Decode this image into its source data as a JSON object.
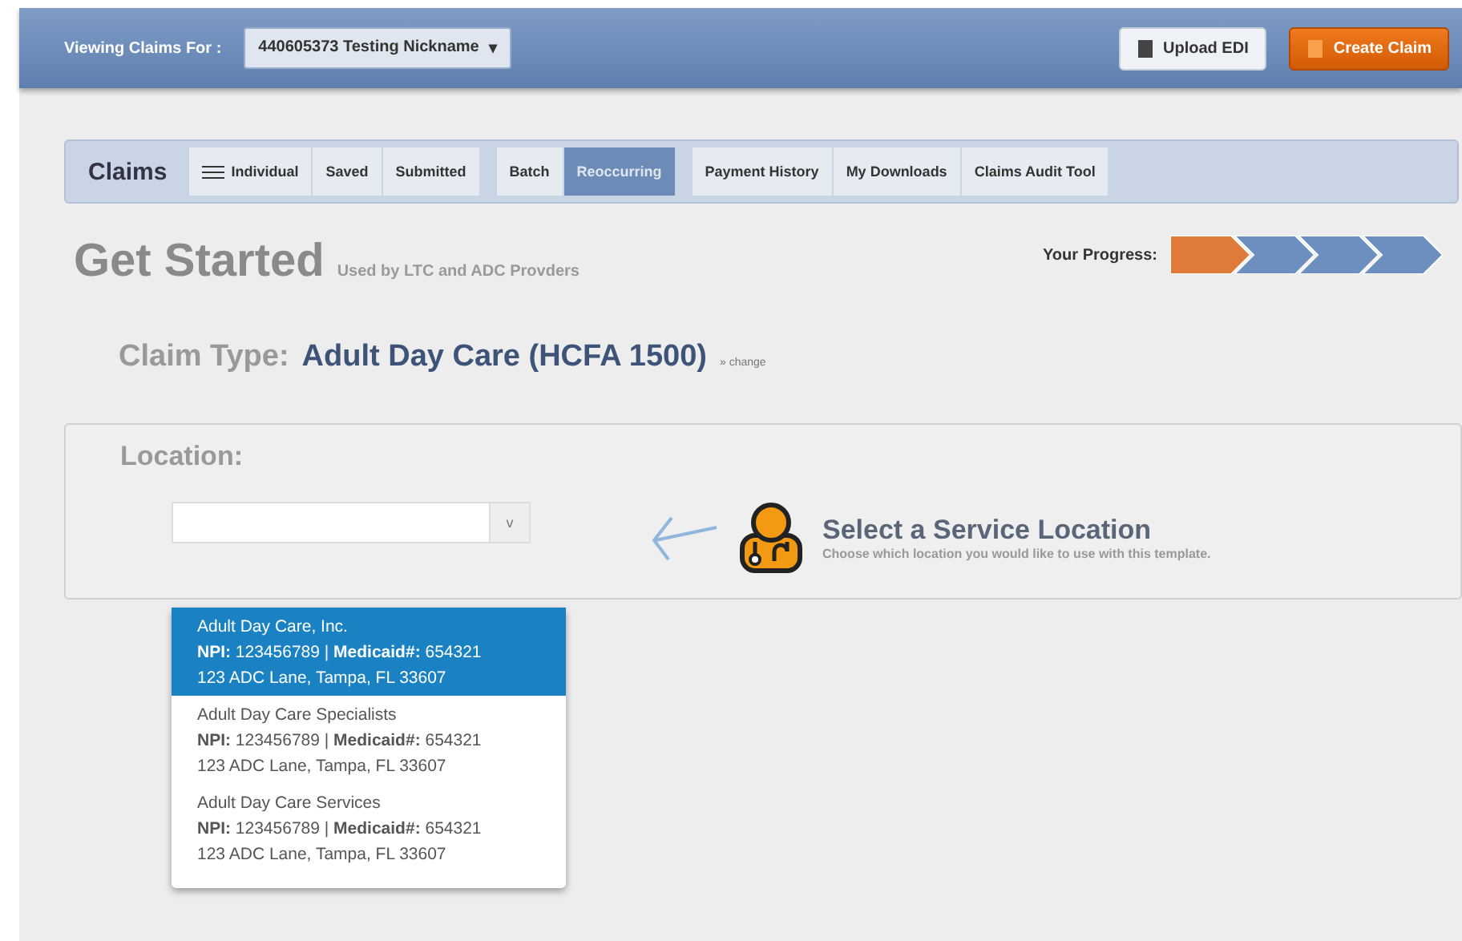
{
  "header": {
    "viewing_label": "Viewing Claims For :",
    "account": "440605373 Testing Nickname",
    "caret": "▾",
    "buttons": [
      {
        "kind": "secondary",
        "label": "Upload EDI"
      },
      {
        "kind": "primary",
        "label": "Create Claim"
      }
    ]
  },
  "nav": {
    "title": "Claims",
    "groups": [
      [
        {
          "label": "Individual",
          "kind": "menu",
          "selected": false
        },
        {
          "label": "Saved",
          "kind": "plain",
          "selected": false
        },
        {
          "label": "Submitted",
          "kind": "plain",
          "selected": false
        }
      ],
      [
        {
          "label": "Batch",
          "kind": "plain",
          "selected": false
        },
        {
          "label": "Reoccurring",
          "kind": "plain",
          "selected": true
        }
      ],
      [
        {
          "label": "Payment History",
          "kind": "plain",
          "selected": false
        },
        {
          "label": "My Downloads",
          "kind": "plain",
          "selected": false
        },
        {
          "label": "Claims Audit Tool",
          "kind": "plain",
          "selected": false
        }
      ]
    ]
  },
  "heading": {
    "title": "Get Started",
    "subtitle": "Used by LTC and ADC Provders"
  },
  "progress": {
    "label": "Your Progress:",
    "steps": [
      {
        "selected": true
      },
      {
        "selected": false
      },
      {
        "selected": false
      },
      {
        "selected": false
      }
    ]
  },
  "claim_type": {
    "label": "Claim Type:",
    "value": "Adult Day Care (HCFA 1500)",
    "change_link": "» change"
  },
  "location": {
    "label": "Location:",
    "select_caret": "v",
    "hint_title": "Select a Service Location",
    "hint_text": "Choose which location you would like to use with this template.",
    "options": [
      {
        "name": "Adult Day Care, Inc.",
        "ids": "**NPI:** 123456789 | **Medicaid#:** 654321",
        "address": "123 ADC Lane, Tampa, FL 33607",
        "selected": true
      },
      {
        "name": "Adult Day Care Specialists",
        "ids": "**NPI:** 123456789 | **Medicaid#:** 654321",
        "address": "123 ADC Lane, Tampa, FL 33607",
        "selected": false
      },
      {
        "name": "Adult Day Care Services",
        "ids": "**NPI:** 123456789 | **Medicaid#:** 654321",
        "address": "123 ADC Lane, Tampa, FL 33607",
        "selected": false
      }
    ]
  }
}
